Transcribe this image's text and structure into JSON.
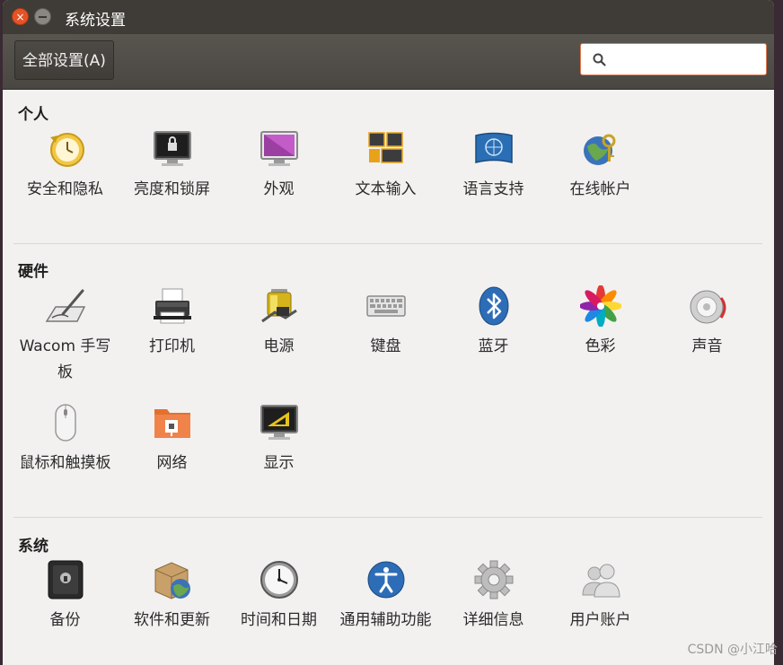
{
  "window": {
    "title": "系统设置",
    "close_glyph": "×"
  },
  "toolbar": {
    "all_settings_label": "全部设置(A)",
    "search_placeholder": ""
  },
  "sections": {
    "personal": {
      "title": "个人",
      "items": [
        {
          "label": "安全和隐私",
          "icon": "security-privacy-icon"
        },
        {
          "label": "亮度和锁屏",
          "icon": "brightness-lock-icon"
        },
        {
          "label": "外观",
          "icon": "appearance-icon"
        },
        {
          "label": "文本输入",
          "icon": "text-entry-icon"
        },
        {
          "label": "语言支持",
          "icon": "language-support-icon"
        },
        {
          "label": "在线帐户",
          "icon": "online-accounts-icon"
        }
      ]
    },
    "hardware": {
      "title": "硬件",
      "items": [
        {
          "label": "Wacom 手写板",
          "icon": "wacom-tablet-icon"
        },
        {
          "label": "打印机",
          "icon": "printer-icon"
        },
        {
          "label": "电源",
          "icon": "power-icon"
        },
        {
          "label": "键盘",
          "icon": "keyboard-icon"
        },
        {
          "label": "蓝牙",
          "icon": "bluetooth-icon"
        },
        {
          "label": "色彩",
          "icon": "color-icon"
        },
        {
          "label": "声音",
          "icon": "sound-icon"
        },
        {
          "label": "鼠标和触摸板",
          "icon": "mouse-touchpad-icon"
        },
        {
          "label": "网络",
          "icon": "network-icon"
        },
        {
          "label": "显示",
          "icon": "display-icon"
        }
      ]
    },
    "system": {
      "title": "系统",
      "items": [
        {
          "label": "备份",
          "icon": "backup-icon"
        },
        {
          "label": "软件和更新",
          "icon": "software-updates-icon"
        },
        {
          "label": "时间和日期",
          "icon": "time-date-icon"
        },
        {
          "label": "通用辅助功能",
          "icon": "universal-access-icon"
        },
        {
          "label": "详细信息",
          "icon": "details-icon"
        },
        {
          "label": "用户账户",
          "icon": "user-accounts-icon"
        }
      ]
    }
  },
  "watermark": "CSDN @小江哈",
  "colors": {
    "titlebar": "#3f3c37",
    "close": "#e45327",
    "body": "#f2f1f0",
    "search_border": "#e07a4f"
  }
}
